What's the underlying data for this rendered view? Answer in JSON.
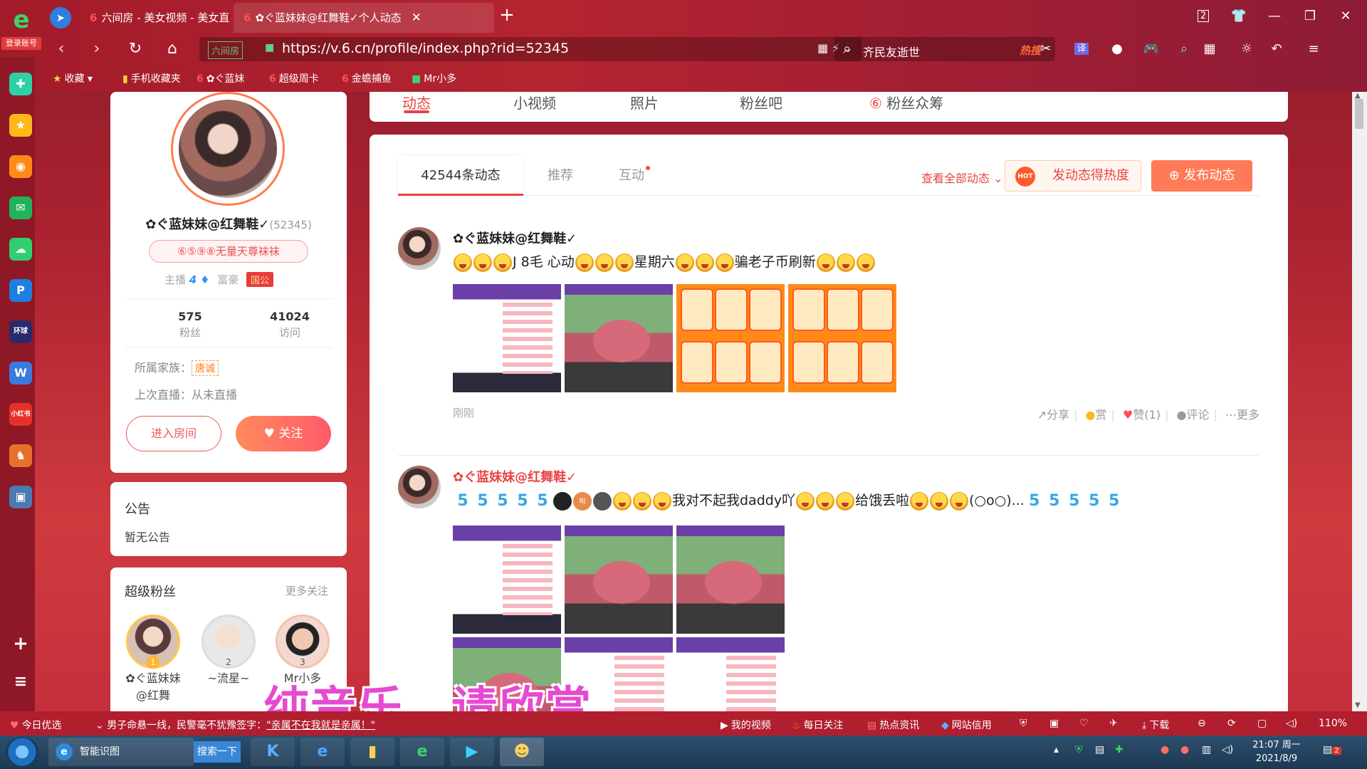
{
  "browser": {
    "login_badge": "登录账号",
    "tabs": [
      {
        "label": "六间房 - 美女视频 - 美女直播",
        "active": false
      },
      {
        "label": "✿ぐ蓝妹妹@红舞鞋✓个人动态",
        "active": true
      }
    ],
    "new_tab": "+",
    "tab_count": "2",
    "url": "https://v.6.cn/profile/index.php?rid=52345",
    "site_badge": "六间房",
    "search_text": "齐民友逝世",
    "search_hot": "热搜",
    "translate_label": "译",
    "bookmarks": [
      "收藏",
      "手机收藏夹",
      "✿ぐ蓝妹",
      "超级周卡",
      "金蟾捕鱼",
      "Mr小多"
    ]
  },
  "profile": {
    "name": "✿ぐ蓝妹妹@红舞鞋✓",
    "rid": "(52345)",
    "tag": "⑥⑤⑨⑧无量天尊袜袜",
    "host_label": "主播",
    "host_level": "4",
    "rich_label": "富豪",
    "rich_badge": "国公",
    "fans_count": "575",
    "fans_label": "粉丝",
    "visits_count": "41024",
    "visits_label": "访问",
    "family_label": "所属家族：",
    "family_value": "唐诚",
    "last_live_label": "上次直播：从未直播",
    "enter_room": "进入房间",
    "follow": "关注"
  },
  "notice": {
    "title": "公告",
    "text": "暂无公告"
  },
  "super_fans": {
    "title": "超级粉丝",
    "more": "更多关注",
    "fans": [
      {
        "rank": "1",
        "name": "✿ぐ蓝妹妹@红舞"
      },
      {
        "rank": "2",
        "name": "~流星~"
      },
      {
        "rank": "3",
        "name": "Mr小多"
      }
    ]
  },
  "top_tabs": [
    "动态",
    "小视频",
    "照片",
    "粉丝吧",
    "粉丝众筹"
  ],
  "feed": {
    "tabs": [
      "42544条动态",
      "推荐",
      "互动"
    ],
    "view_all": "查看全部动态",
    "hot_button": "发动态得热度",
    "hot_icon": "HOT",
    "post_button": "发布动态",
    "posts": [
      {
        "name": "✿ぐ蓝妹妹@红舞鞋✓",
        "text_a": "J 8毛 心动",
        "text_b": "星期六",
        "text_c": "骗老子币刷新",
        "time": "刚刚",
        "actions": {
          "share": "分享",
          "reward": "赏",
          "like": "赞(1)",
          "comment": "评论",
          "more": "更多"
        }
      },
      {
        "name": "✿ぐ蓝妹妹@红舞鞋✓",
        "bj_label": "BJ",
        "text_a": "我对不起我daddy吖",
        "text_b": "给饿丢啦",
        "text_c": "(○o○)..."
      }
    ]
  },
  "subtitle": "纯音乐，请欣赏",
  "statusbar": {
    "news_label": "今日优选",
    "ticker_prefix": "男子命悬一线，民警毫不犹豫签字：",
    "ticker_link": "\"亲属不在我就是亲属！\"",
    "my_video": "我的视频",
    "daily": "每日关注",
    "hot_news": "热点资讯",
    "credit": "网站信用",
    "download": "下载",
    "zoom": "110%"
  },
  "taskbar": {
    "app_label": "智能识图",
    "search_btn": "搜索一下",
    "time": "21:07 周一",
    "date": "2021/8/9",
    "notify_count": "2"
  }
}
